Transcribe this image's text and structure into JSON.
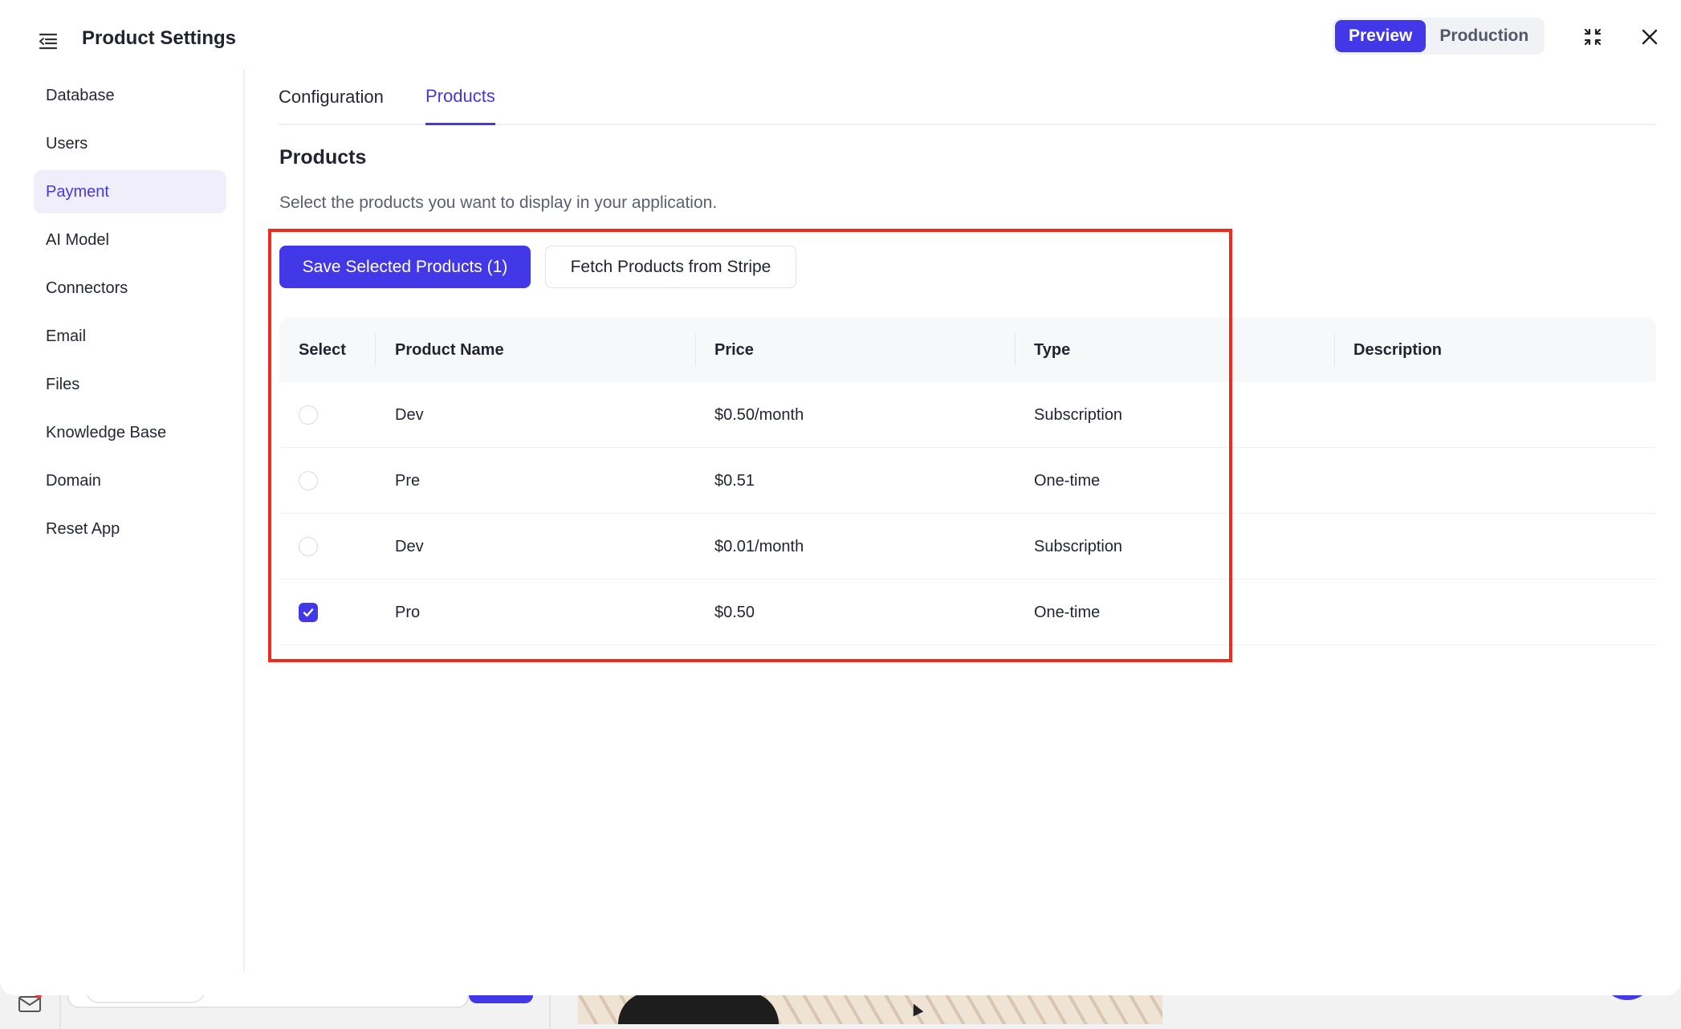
{
  "header": {
    "title": "Product Settings",
    "env_preview": "Preview",
    "env_production": "Production"
  },
  "sidebar": {
    "items": [
      {
        "label": "Database"
      },
      {
        "label": "Users"
      },
      {
        "label": "Payment",
        "active": true
      },
      {
        "label": "AI Model"
      },
      {
        "label": "Connectors"
      },
      {
        "label": "Email"
      },
      {
        "label": "Files"
      },
      {
        "label": "Knowledge Base"
      },
      {
        "label": "Domain"
      },
      {
        "label": "Reset App"
      }
    ]
  },
  "tabs": [
    {
      "label": "Configuration"
    },
    {
      "label": "Products",
      "active": true
    }
  ],
  "products_section": {
    "title": "Products",
    "description": "Select the products you want to display in your application.",
    "save_button": "Save Selected Products (1)",
    "fetch_button": "Fetch Products from Stripe"
  },
  "table": {
    "headers": [
      "Select",
      "Product Name",
      "Price",
      "Type",
      "Description"
    ],
    "rows": [
      {
        "selected": false,
        "name": "Dev",
        "price": "$0.50/month",
        "type": "Subscription",
        "description": ""
      },
      {
        "selected": false,
        "name": "Pre",
        "price": "$0.51",
        "type": "One-time",
        "description": ""
      },
      {
        "selected": false,
        "name": "Dev",
        "price": "$0.01/month",
        "type": "Subscription",
        "description": ""
      },
      {
        "selected": true,
        "name": "Pro",
        "price": "$0.50",
        "type": "One-time",
        "description": ""
      }
    ]
  },
  "colors": {
    "accent": "#4338e8",
    "highlight_border": "#f02a1c"
  }
}
